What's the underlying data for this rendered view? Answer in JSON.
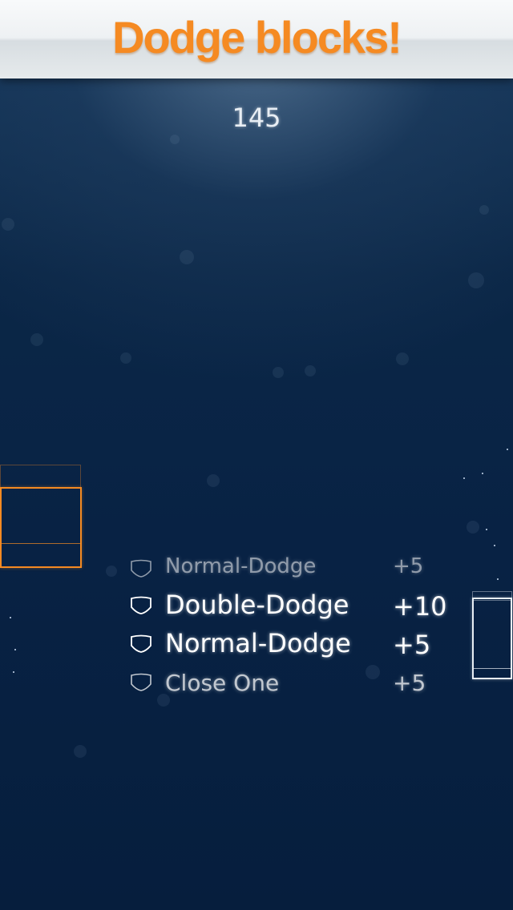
{
  "header": {
    "title": "Dodge blocks!"
  },
  "score": {
    "value": "145"
  },
  "dodge_log": [
    {
      "label": "Normal-Dodge",
      "points": "+5",
      "icon": "shield-icon"
    },
    {
      "label": "Double-Dodge",
      "points": "+10",
      "icon": "shield-icon"
    },
    {
      "label": "Normal-Dodge",
      "points": "+5",
      "icon": "shield-icon"
    },
    {
      "label": "Close One",
      "points": "+5",
      "icon": "shield-icon"
    }
  ],
  "colors": {
    "accent": "#f58a22",
    "background": "#0a2240",
    "text": "#ffffff"
  }
}
